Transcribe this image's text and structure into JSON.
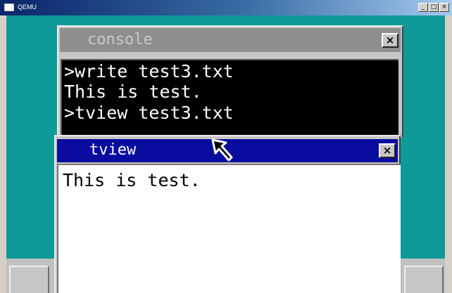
{
  "host_window": {
    "title": "QEMU",
    "controls": {
      "minimize": "_",
      "maximize": "□",
      "close": "×"
    }
  },
  "console_window": {
    "title": "console",
    "close_label": "×",
    "lines": [
      ">write test3.txt",
      "This is test.",
      ">tview test3.txt"
    ]
  },
  "tview_window": {
    "title": "tview",
    "close_label": "×",
    "content": "This is test."
  },
  "colors": {
    "desktop": "#0f9999",
    "active_titlebar": "#0a0ca0",
    "inactive_titlebar": "#8e8e8e",
    "console_background": "#000000",
    "console_text": "#ffffff"
  },
  "icons": {
    "app_icon": "qemu-app-icon",
    "pointer": "mouse-pointer-icon"
  }
}
